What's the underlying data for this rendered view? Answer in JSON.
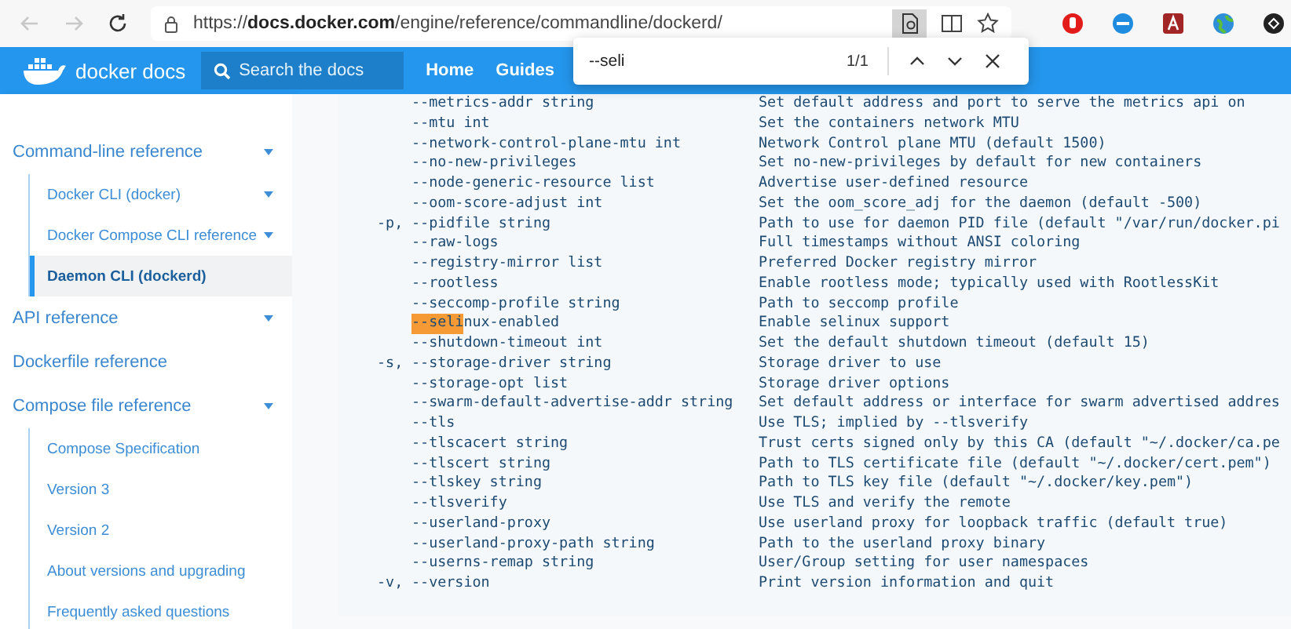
{
  "browser": {
    "url_domain": "docs.docker.com",
    "url_path": "/engine/reference/commandline/dockerd/",
    "url_scheme": "https://"
  },
  "find_bar": {
    "value": "--seli",
    "count": "1/1"
  },
  "nav": {
    "logo": "docker docs",
    "search": {
      "placeholder": "Search the docs"
    },
    "links": [
      "Home",
      "Guides"
    ]
  },
  "sidebar": {
    "items": [
      {
        "label": "Command-line reference",
        "expandable": true,
        "selected": false,
        "children": [
          {
            "label": "Docker CLI (docker)",
            "expandable": true,
            "selected": false
          },
          {
            "label": "Docker Compose CLI reference",
            "expandable": true,
            "selected": false
          },
          {
            "label": "Daemon CLI (dockerd)",
            "expandable": false,
            "selected": true
          }
        ]
      },
      {
        "label": "API reference",
        "expandable": true,
        "selected": false
      },
      {
        "label": "Dockerfile reference",
        "expandable": false,
        "selected": false
      },
      {
        "label": "Compose file reference",
        "expandable": true,
        "selected": false,
        "children": [
          {
            "label": "Compose Specification",
            "expandable": false,
            "selected": false
          },
          {
            "label": "Version 3",
            "expandable": false,
            "selected": false
          },
          {
            "label": "Version 2",
            "expandable": false,
            "selected": false
          },
          {
            "label": "About versions and upgrading",
            "expandable": false,
            "selected": false
          },
          {
            "label": "Frequently asked questions",
            "expandable": false,
            "selected": false
          }
        ]
      }
    ]
  },
  "code_rows": [
    {
      "flag": "--metrics-addr string",
      "desc": "Set default address and port to serve the metrics api on"
    },
    {
      "flag": "--mtu int",
      "desc": "Set the containers network MTU"
    },
    {
      "flag": "--network-control-plane-mtu int",
      "desc": "Network Control plane MTU (default 1500)"
    },
    {
      "flag": "--no-new-privileges",
      "desc": "Set no-new-privileges by default for new containers"
    },
    {
      "flag": "--node-generic-resource list",
      "desc": "Advertise user-defined resource"
    },
    {
      "flag": "--oom-score-adjust int",
      "desc": "Set the oom_score_adj for the daemon (default -500)"
    },
    {
      "short": "-p,",
      "flag": "--pidfile string",
      "desc": "Path to use for daemon PID file (default \"/var/run/docker.pi"
    },
    {
      "flag": "--raw-logs",
      "desc": "Full timestamps without ANSI coloring"
    },
    {
      "flag": "--registry-mirror list",
      "desc": "Preferred Docker registry mirror"
    },
    {
      "flag": "--rootless",
      "desc": "Enable rootless mode; typically used with RootlessKit"
    },
    {
      "flag": "--seccomp-profile string",
      "desc": "Path to seccomp profile"
    },
    {
      "match": "--seli",
      "flag": "nux-enabled",
      "desc": "Enable selinux support"
    },
    {
      "flag": "--shutdown-timeout int",
      "desc": "Set the default shutdown timeout (default 15)"
    },
    {
      "short": "-s,",
      "flag": "--storage-driver string",
      "desc": "Storage driver to use"
    },
    {
      "flag": "--storage-opt list",
      "desc": "Storage driver options"
    },
    {
      "flag": "--swarm-default-advertise-addr string",
      "desc": "Set default address or interface for swarm advertised addres"
    },
    {
      "flag": "--tls",
      "desc": "Use TLS; implied by --tlsverify"
    },
    {
      "flag": "--tlscacert string",
      "desc": "Trust certs signed only by this CA (default \"~/.docker/ca.pe"
    },
    {
      "flag": "--tlscert string",
      "desc": "Path to TLS certificate file (default \"~/.docker/cert.pem\")"
    },
    {
      "flag": "--tlskey string",
      "desc": "Path to TLS key file (default \"~/.docker/key.pem\")"
    },
    {
      "flag": "--tlsverify",
      "desc": "Use TLS and verify the remote"
    },
    {
      "flag": "--userland-proxy",
      "desc": "Use userland proxy for loopback traffic (default true)"
    },
    {
      "flag": "--userland-proxy-path string",
      "desc": "Path to the userland proxy binary"
    },
    {
      "flag": "--userns-remap string",
      "desc": "User/Group setting for user namespaces"
    },
    {
      "short": "-v,",
      "flag": "--version",
      "desc": "Print version information and quit"
    }
  ]
}
